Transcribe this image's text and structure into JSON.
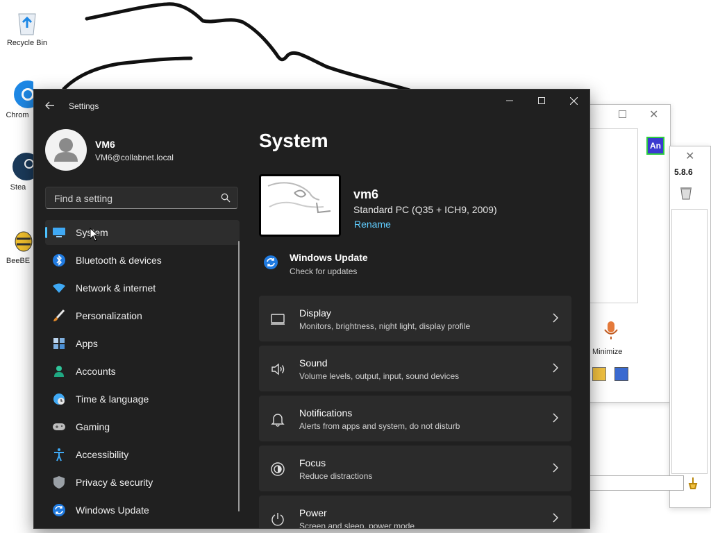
{
  "desktop": {
    "icons": [
      {
        "label": "Recycle Bin",
        "icon": "recycle-bin-icon"
      },
      {
        "label": "Chrom",
        "icon": "chrome-icon"
      },
      {
        "label": "Stea",
        "icon": "steam-icon"
      },
      {
        "label": "BeeBE",
        "icon": "beebeep-icon"
      }
    ]
  },
  "background_window": {
    "badge": "An",
    "version": "5.8.6",
    "minimize_label": "Minimize"
  },
  "settings": {
    "window_title": "Settings",
    "user": {
      "name": "VM6",
      "email": "VM6@collabnet.local"
    },
    "search": {
      "placeholder": "Find a setting"
    },
    "nav": [
      {
        "label": "System",
        "icon": "monitor-icon",
        "active": true
      },
      {
        "label": "Bluetooth & devices",
        "icon": "bluetooth-icon"
      },
      {
        "label": "Network & internet",
        "icon": "wifi-icon"
      },
      {
        "label": "Personalization",
        "icon": "brush-icon"
      },
      {
        "label": "Apps",
        "icon": "apps-icon"
      },
      {
        "label": "Accounts",
        "icon": "person-icon"
      },
      {
        "label": "Time & language",
        "icon": "clock-globe-icon"
      },
      {
        "label": "Gaming",
        "icon": "gamepad-icon"
      },
      {
        "label": "Accessibility",
        "icon": "accessibility-icon"
      },
      {
        "label": "Privacy & security",
        "icon": "shield-icon"
      },
      {
        "label": "Windows Update",
        "icon": "update-icon"
      }
    ],
    "main": {
      "title": "System",
      "device": {
        "name": "vm6",
        "model": "Standard PC (Q35 + ICH9, 2009)",
        "rename": "Rename"
      },
      "windows_update": {
        "title": "Windows Update",
        "subtitle": "Check for updates"
      },
      "cards": [
        {
          "title": "Display",
          "subtitle": "Monitors, brightness, night light, display profile",
          "icon": "display-icon"
        },
        {
          "title": "Sound",
          "subtitle": "Volume levels, output, input, sound devices",
          "icon": "speaker-icon"
        },
        {
          "title": "Notifications",
          "subtitle": "Alerts from apps and system, do not disturb",
          "icon": "bell-icon"
        },
        {
          "title": "Focus",
          "subtitle": "Reduce distractions",
          "icon": "focus-icon"
        },
        {
          "title": "Power",
          "subtitle": "Screen and sleep, power mode",
          "icon": "power-icon"
        }
      ]
    },
    "colors": {
      "accent": "#4cc2ff",
      "link": "#60cdff",
      "window_bg": "#202020",
      "card_bg": "#2b2b2b"
    }
  }
}
